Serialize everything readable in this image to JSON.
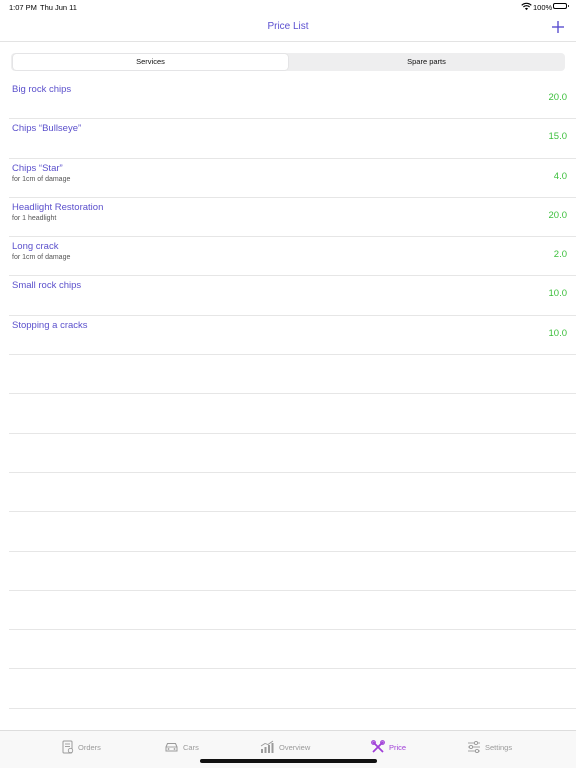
{
  "status_bar": {
    "time": "1:07 PM",
    "date": "Thu Jun 11",
    "battery": "100%"
  },
  "nav": {
    "title": "Price List",
    "add_icon": "plus-icon"
  },
  "segments": {
    "services": "Services",
    "spare_parts": "Spare parts",
    "selected": "Services"
  },
  "items": [
    {
      "name": "Big rock chips",
      "sub": "",
      "price": "20.0"
    },
    {
      "name": "Chips “Bullseye”",
      "sub": "",
      "price": "15.0"
    },
    {
      "name": "Chips “Star”",
      "sub": "for 1cm of damage",
      "price": "4.0"
    },
    {
      "name": "Headlight Restoration",
      "sub": "for 1 headlight",
      "price": "20.0"
    },
    {
      "name": "Long crack",
      "sub": "for 1cm of damage",
      "price": "2.0"
    },
    {
      "name": "Small rock chips",
      "sub": "",
      "price": "10.0"
    },
    {
      "name": "Stopping a cracks",
      "sub": "",
      "price": "10.0"
    }
  ],
  "tabs": [
    {
      "label": "Orders",
      "icon": "orders-icon"
    },
    {
      "label": "Cars",
      "icon": "car-icon"
    },
    {
      "label": "Overview",
      "icon": "chart-icon"
    },
    {
      "label": "Price",
      "icon": "tools-icon"
    },
    {
      "label": "Settings",
      "icon": "sliders-icon"
    }
  ],
  "colors": {
    "accent": "#5b4fd0",
    "price": "#3bbf3b",
    "active_tab": "#a03fd8",
    "inactive_tab": "#9a9a9a"
  }
}
